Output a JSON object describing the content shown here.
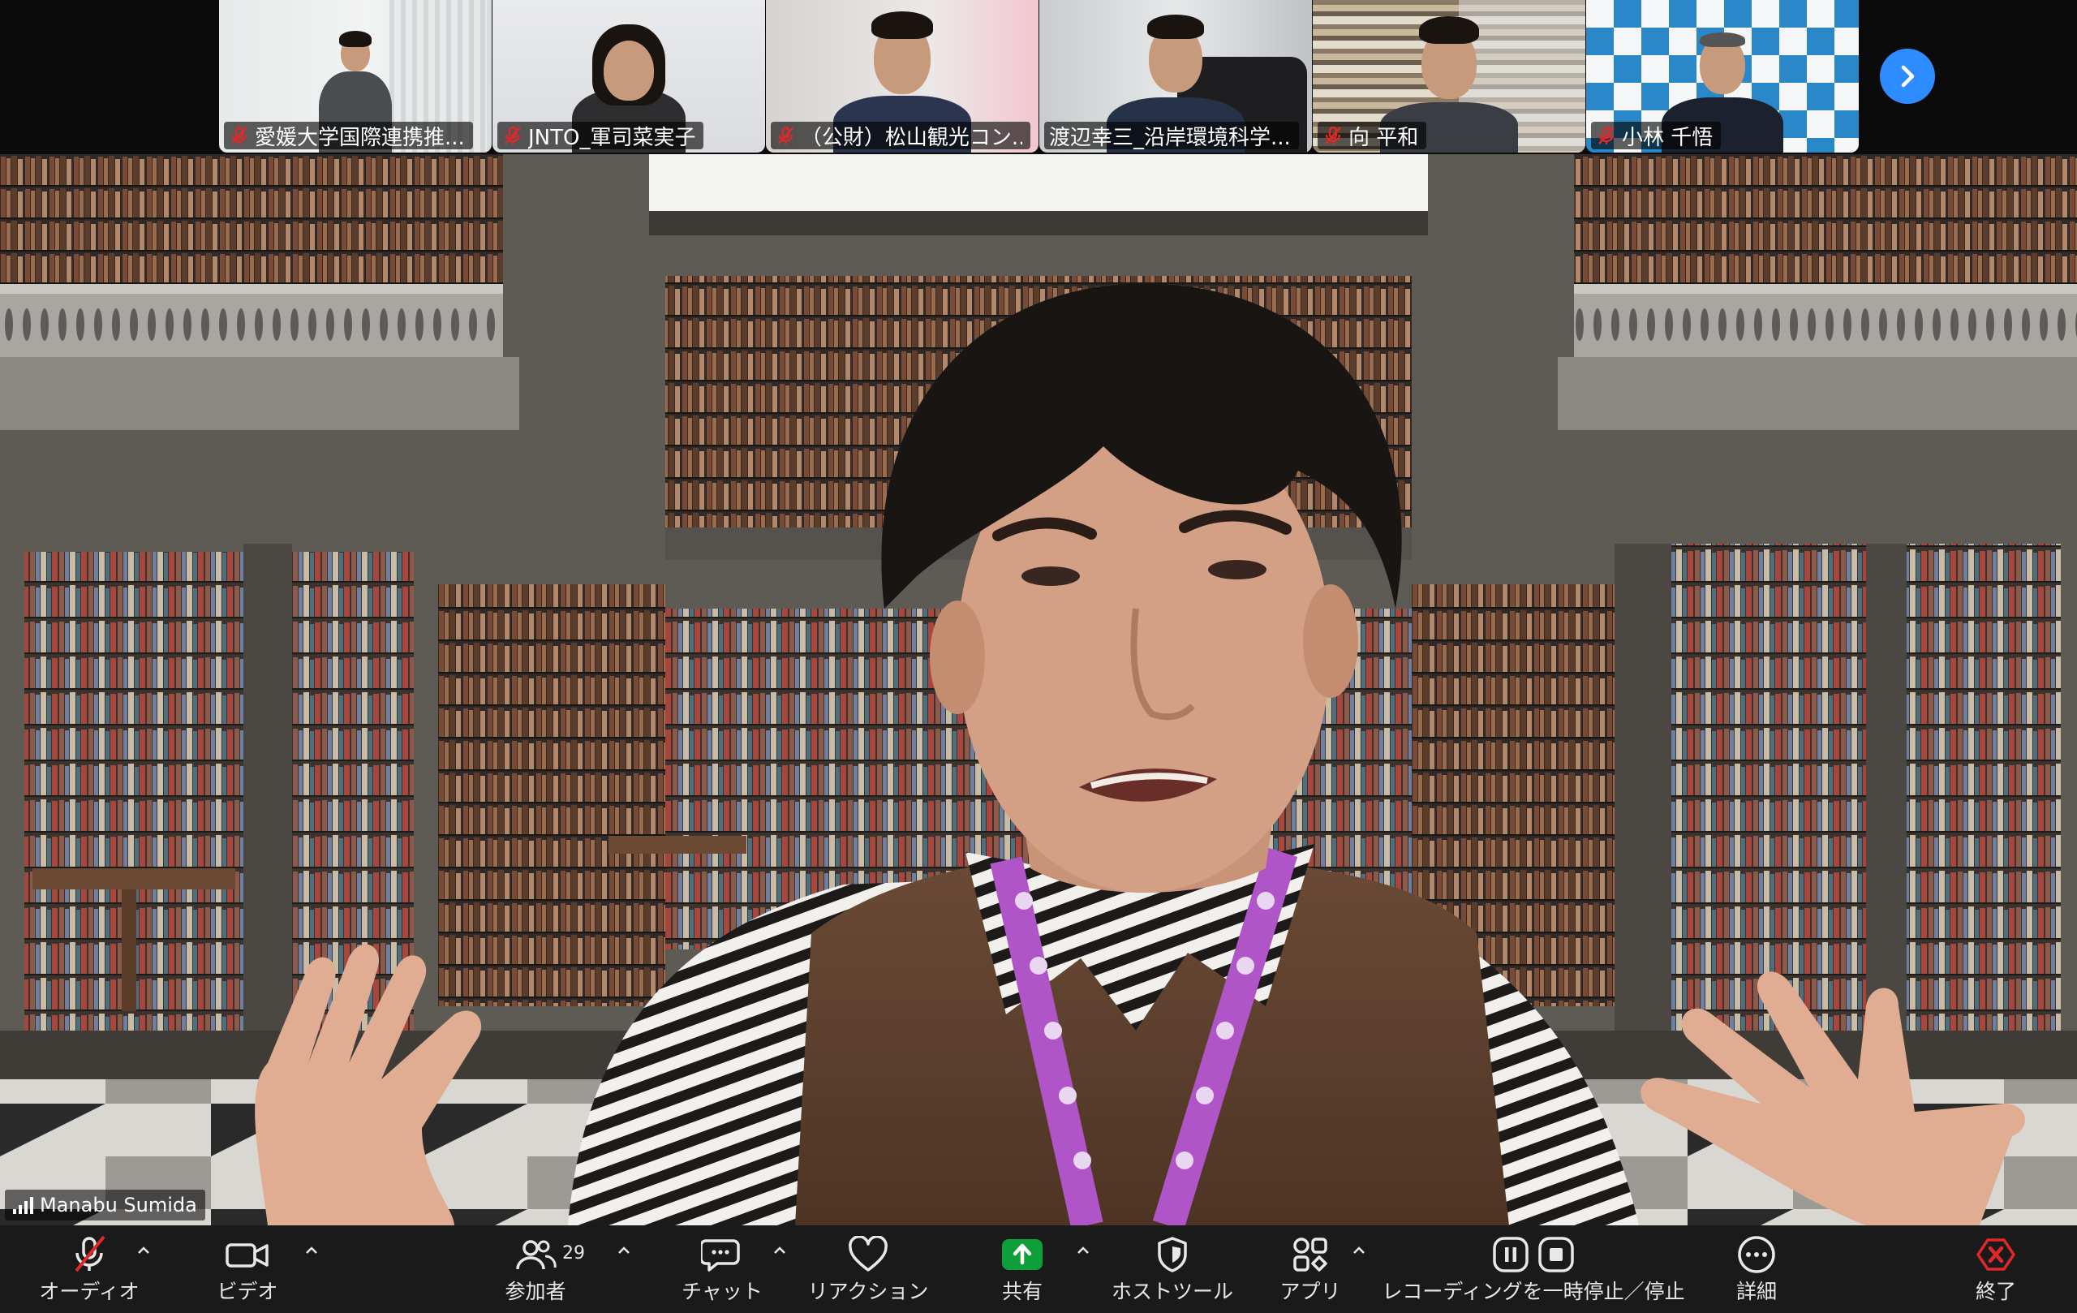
{
  "participants_strip": [
    {
      "name": "愛媛大学国際連携推...",
      "muted": true
    },
    {
      "name": "JNTO_軍司菜実子",
      "muted": true
    },
    {
      "name": "（公財）松山観光コン...",
      "muted": true
    },
    {
      "name": "渡辺幸三_沿岸環境科学...",
      "muted": false
    },
    {
      "name": "向 平和",
      "muted": true
    },
    {
      "name": "小林 千悟",
      "muted": true
    }
  ],
  "active_speaker": {
    "name": "Manabu Sumida"
  },
  "toolbar": {
    "audio_label": "オーディオ",
    "video_label": "ビデオ",
    "participants_label": "参加者",
    "participants_count": "29",
    "chat_label": "チャット",
    "reactions_label": "リアクション",
    "share_label": "共有",
    "host_tools_label": "ホストツール",
    "apps_label": "アプリ",
    "recording_label": "レコーディングを一時停止／停止",
    "more_label": "詳細",
    "end_label": "終了"
  },
  "colors": {
    "toolbar_bg": "#1a1a1a",
    "share_green": "#0e9f3b",
    "end_red": "#e02828",
    "accent_blue": "#2d8cff",
    "mute_red": "#e02828"
  }
}
